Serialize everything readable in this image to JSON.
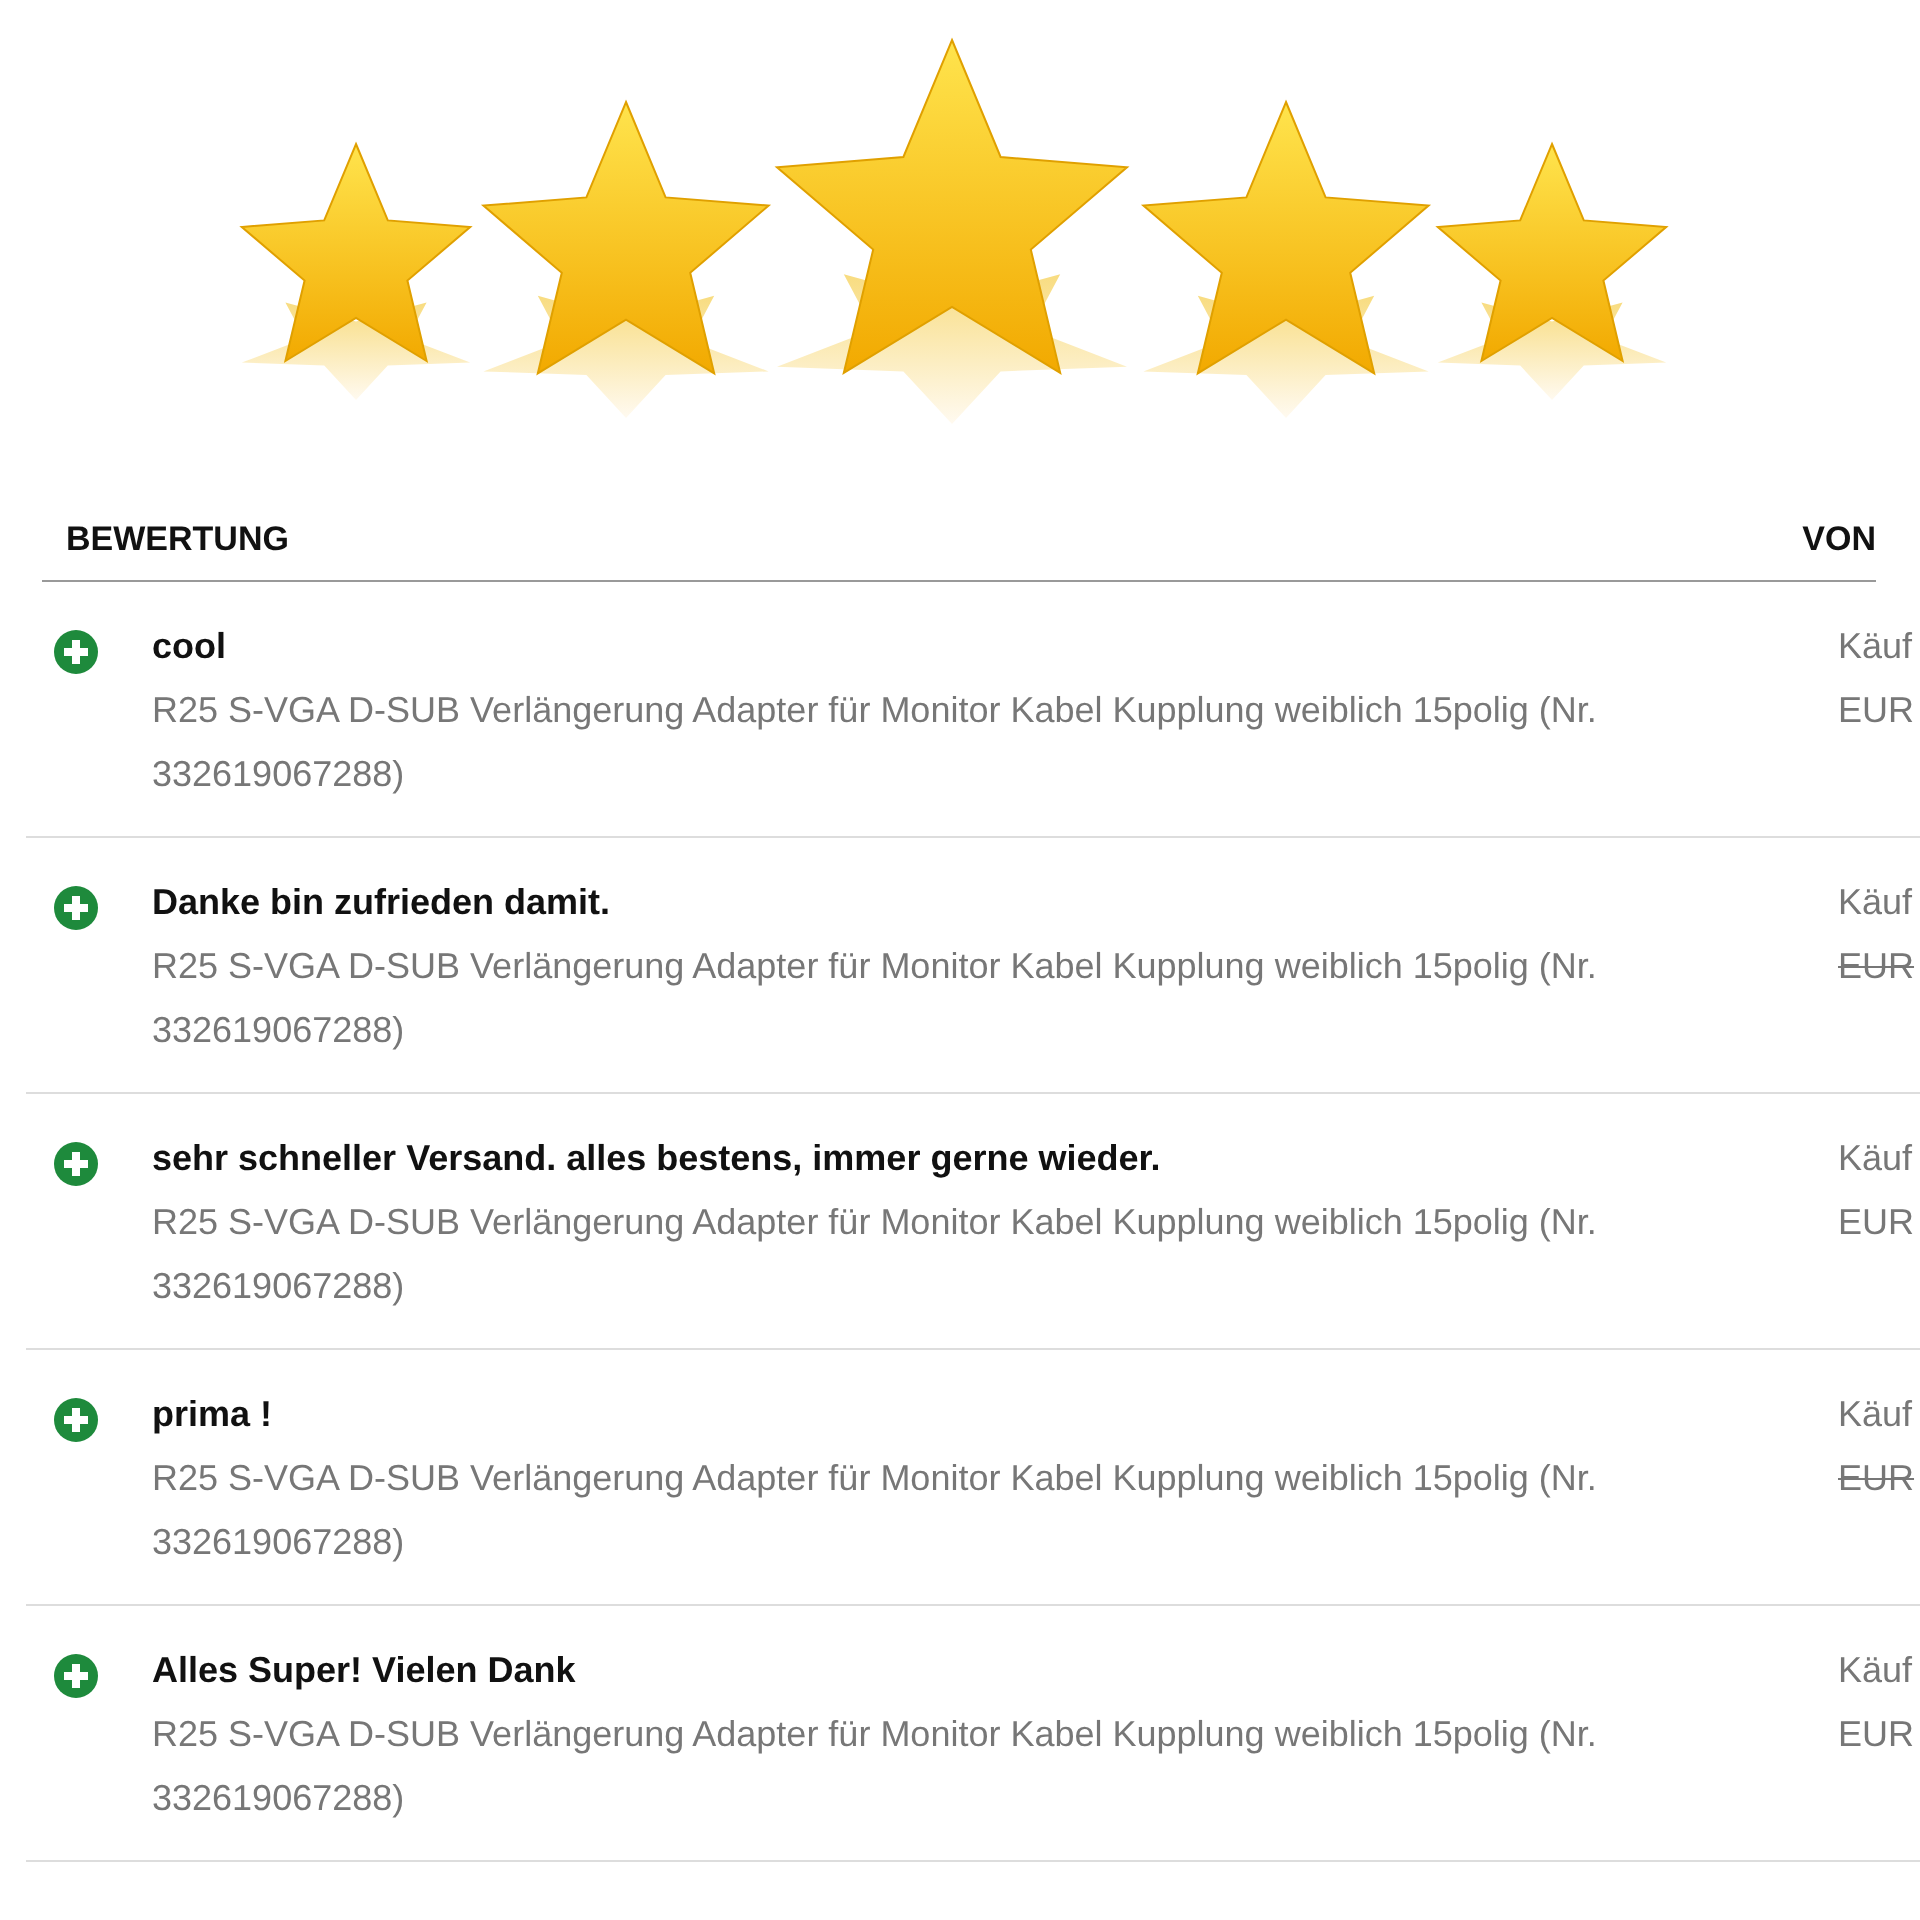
{
  "table": {
    "columns": [
      "BEWERTUNG",
      "VON"
    ],
    "rows": [
      {
        "kind": "positive",
        "comment": "cool",
        "item": "R25 S-VGA D-SUB Verlängerung Adapter für Monitor Kabel Kupplung weiblich 15polig (Nr. 332619067288)",
        "from": "Käuf",
        "price": "EUR",
        "price_struck": false
      },
      {
        "kind": "positive",
        "comment": "Danke bin zufrieden damit.",
        "item": "R25 S-VGA D-SUB Verlängerung Adapter für Monitor Kabel Kupplung weiblich 15polig (Nr. 332619067288)",
        "from": "Käuf",
        "price": "EUR",
        "price_struck": true
      },
      {
        "kind": "positive",
        "comment": "sehr schneller Versand. alles bestens, immer gerne wieder.",
        "item": "R25 S-VGA D-SUB Verlängerung Adapter für Monitor Kabel Kupplung weiblich 15polig (Nr. 332619067288)",
        "from": "Käuf",
        "price": "EUR",
        "price_struck": false
      },
      {
        "kind": "positive",
        "comment": "prima !",
        "item": "R25 S-VGA D-SUB Verlängerung Adapter für Monitor Kabel Kupplung weiblich 15polig (Nr. 332619067288)",
        "from": "Käuf",
        "price": "EUR",
        "price_struck": true
      },
      {
        "kind": "positive",
        "comment": "Alles Super! Vielen Dank",
        "item": "R25 S-VGA D-SUB Verlängerung Adapter für Monitor Kabel Kupplung weiblich 15polig (Nr. 332619067288)",
        "from": "Käuf",
        "price": "EUR",
        "price_struck": false
      }
    ]
  }
}
